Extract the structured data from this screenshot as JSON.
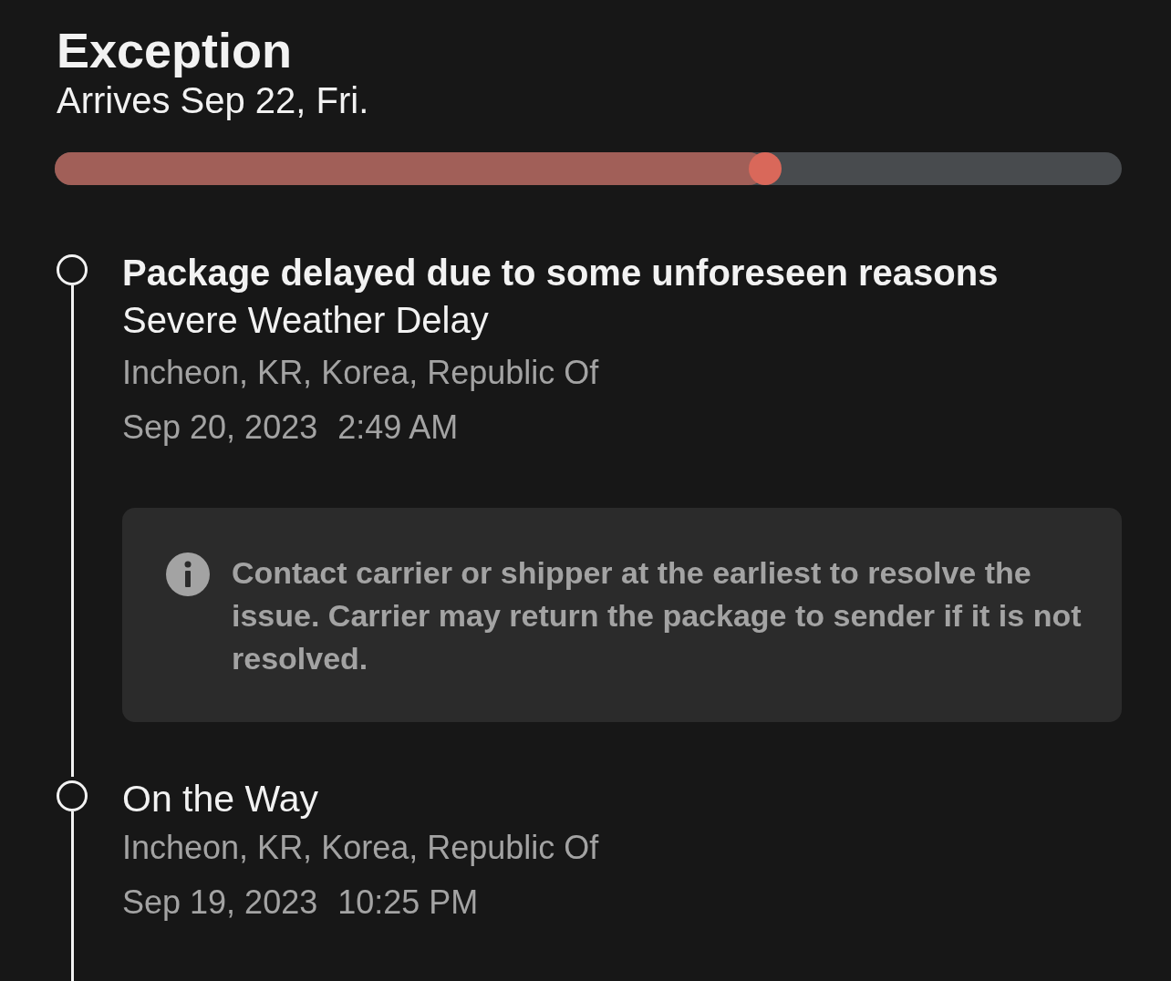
{
  "header": {
    "title": "Exception",
    "subtitle": "Arrives Sep 22, Fri."
  },
  "progress": {
    "level": 0.666
  },
  "events": [
    {
      "title": "Package delayed due to some unforeseen reasons",
      "emphasized": true,
      "detail": "Severe Weather Delay",
      "location": "Incheon, KR, Korea, Republic Of",
      "date": "Sep 20, 2023",
      "time": "2:49 AM",
      "notice": "Contact carrier or shipper at the earliest to resolve the issue. Carrier may return the package to sender if it is not resolved."
    },
    {
      "title": "On the Way",
      "emphasized": false,
      "location": "Incheon, KR, Korea, Republic Of",
      "date": "Sep 19, 2023",
      "time": "10:25 PM"
    }
  ]
}
